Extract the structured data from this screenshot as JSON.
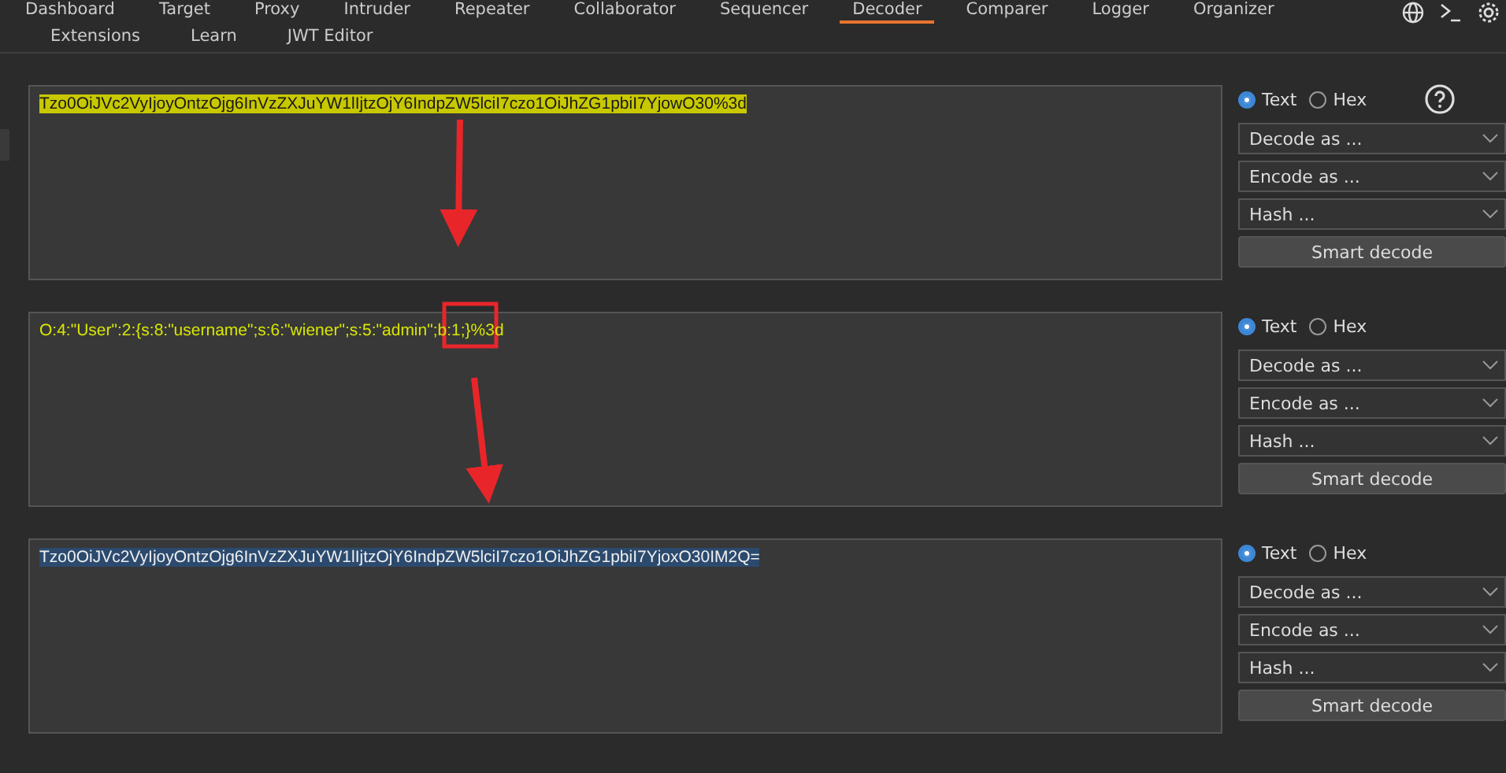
{
  "tabs_row_1": [
    {
      "label": "Dashboard",
      "selected": false
    },
    {
      "label": "Target",
      "selected": false
    },
    {
      "label": "Proxy",
      "selected": false
    },
    {
      "label": "Intruder",
      "selected": false
    },
    {
      "label": "Repeater",
      "selected": false
    },
    {
      "label": "Collaborator",
      "selected": false
    },
    {
      "label": "Sequencer",
      "selected": false
    },
    {
      "label": "Decoder",
      "selected": true
    },
    {
      "label": "Comparer",
      "selected": false
    },
    {
      "label": "Logger",
      "selected": false
    },
    {
      "label": "Organizer",
      "selected": false
    }
  ],
  "tabs_row_2": [
    {
      "label": "Extensions",
      "selected": false
    },
    {
      "label": "Learn",
      "selected": false
    },
    {
      "label": "JWT Editor",
      "selected": false
    }
  ],
  "panels": [
    {
      "content": "Tzo0OiJVc2VyIjoyOntzOjg6InVzZXJuYW1lIjtzOjY6IndpZW5lciI7czo1OiJhZG1pbiI7YjowO30%3d",
      "color": "#c8c800",
      "modes": [
        {
          "label": "Text",
          "selected": true
        },
        {
          "label": "Hex",
          "selected": false
        }
      ],
      "help": true,
      "dropdowns": [
        "Decode as ...",
        "Encode as ...",
        "Hash ..."
      ],
      "button": "Smart decode"
    },
    {
      "content": "O:4:\"User\":2:{s:8:\"username\";s:6:\"wiener\";s:5:\"admin\";b:1;}%3d",
      "modes": [
        {
          "label": "Text",
          "selected": true
        },
        {
          "label": "Hex",
          "selected": false
        }
      ],
      "help": false,
      "dropdowns": [
        "Decode as ...",
        "Encode as ...",
        "Hash ..."
      ],
      "button": "Smart decode"
    },
    {
      "content": "Tzo0OiJVc2VyIjoyOntzOjg6InVzZXJuYW1lIjtzOjY6IndpZW5lciI7czo1OiJhZG1pbiI7YjoxO30IM2Q=",
      "color": "#2b4a6e",
      "modes": [
        {
          "label": "Text",
          "selected": true
        },
        {
          "label": "Hex",
          "selected": false
        }
      ],
      "help": false,
      "dropdowns": [
        "Decode as ...",
        "Encode as ...",
        "Hash ..."
      ],
      "button": "Smart decode"
    }
  ]
}
